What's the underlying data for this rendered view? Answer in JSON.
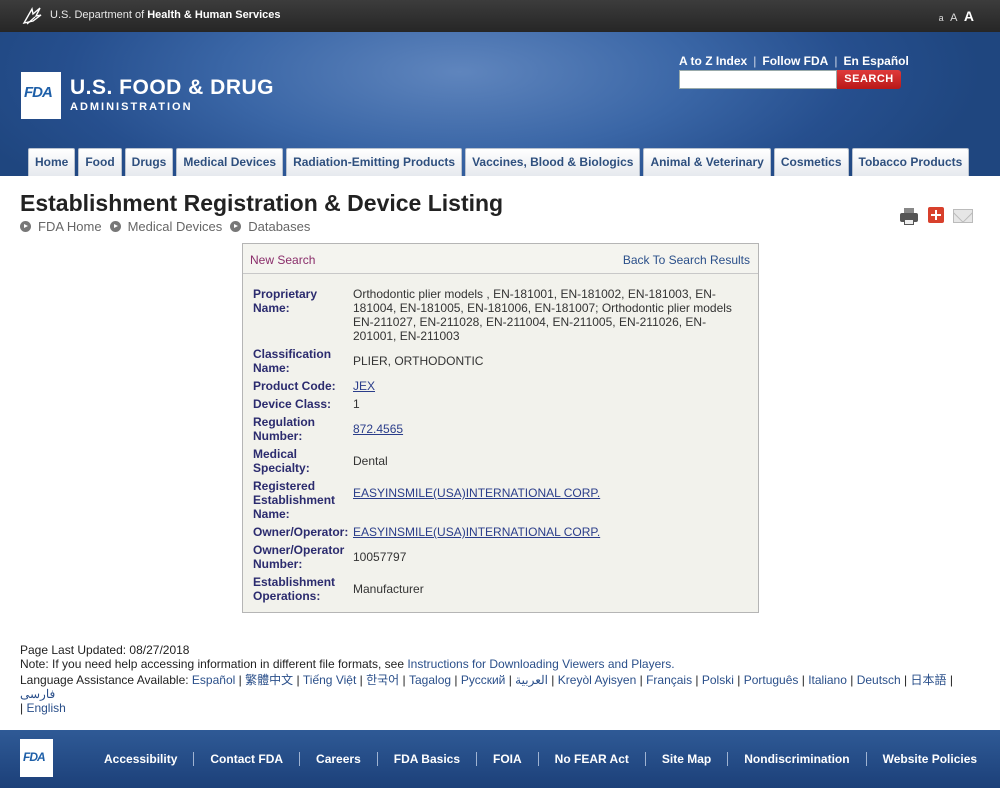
{
  "hhs": {
    "prefix": "U.S. Department of ",
    "name": "Health & Human Services",
    "size_small": "a",
    "size_medium": "A",
    "size_large": "A"
  },
  "header": {
    "logo": "FDA",
    "title": "U.S. FOOD & DRUG",
    "subtitle": "ADMINISTRATION",
    "util_links": [
      "A to Z Index",
      "Follow FDA",
      "En Español"
    ],
    "search_placeholder": "",
    "search_button": "SEARCH"
  },
  "nav": {
    "tabs": [
      "Home",
      "Food",
      "Drugs",
      "Medical Devices",
      "Radiation-Emitting Products",
      "Vaccines, Blood & Biologics",
      "Animal & Veterinary",
      "Cosmetics",
      "Tobacco Products"
    ]
  },
  "page": {
    "title": "Establishment Registration & Device Listing",
    "breadcrumb": [
      "FDA Home",
      "Medical Devices",
      "Databases"
    ]
  },
  "panel": {
    "new_search": "New Search",
    "back_to_results": "Back To Search Results",
    "fields": {
      "proprietary_name_label": "Proprietary Name:",
      "proprietary_name": "Orthodontic plier models , EN-181001, EN-181002, EN-181003, EN-181004, EN-181005, EN-181006, EN-181007; Orthodontic plier models EN-211027, EN-211028, EN-211004, EN-211005, EN-211026, EN-201001, EN-211003",
      "classification_name_label": "Classification Name:",
      "classification_name": "PLIER, ORTHODONTIC",
      "product_code_label": "Product Code:",
      "product_code": "JEX",
      "device_class_label": "Device Class:",
      "device_class": "1",
      "regulation_number_label": "Regulation Number:",
      "regulation_number": "872.4565",
      "medical_specialty_label": "Medical Specialty:",
      "medical_specialty": "Dental",
      "registered_establishment_label": "Registered Establishment Name:",
      "registered_establishment": "EASYINSMILE(USA)INTERNATIONAL CORP.",
      "owner_operator_label": "Owner/Operator:",
      "owner_operator": "EASYINSMILE(USA)INTERNATIONAL CORP.",
      "owner_operator_number_label": "Owner/Operator Number:",
      "owner_operator_number": "10057797",
      "establishment_operations_label": "Establishment Operations:",
      "establishment_operations": "Manufacturer"
    }
  },
  "info": {
    "page_updated": "Page Last Updated: 08/27/2018",
    "note_prefix": "Note: If you need help accessing information in different file formats, see ",
    "note_link": "Instructions for Downloading Viewers and Players.",
    "language_prefix": "Language Assistance Available: ",
    "languages": [
      "Español",
      "繁體中文",
      "Tiếng Việt",
      "한국어",
      "Tagalog",
      "Русский",
      "العربية",
      "Kreyòl Ayisyen",
      "Français",
      "Polski",
      "Português",
      "Italiano",
      "Deutsch",
      "日本語",
      "فارسی",
      "English"
    ]
  },
  "footer": {
    "logo": "FDA",
    "links": [
      "Accessibility",
      "Contact FDA",
      "Careers",
      "FDA Basics",
      "FOIA",
      "No FEAR Act",
      "Site Map",
      "Nondiscrimination",
      "Website Policies"
    ]
  }
}
